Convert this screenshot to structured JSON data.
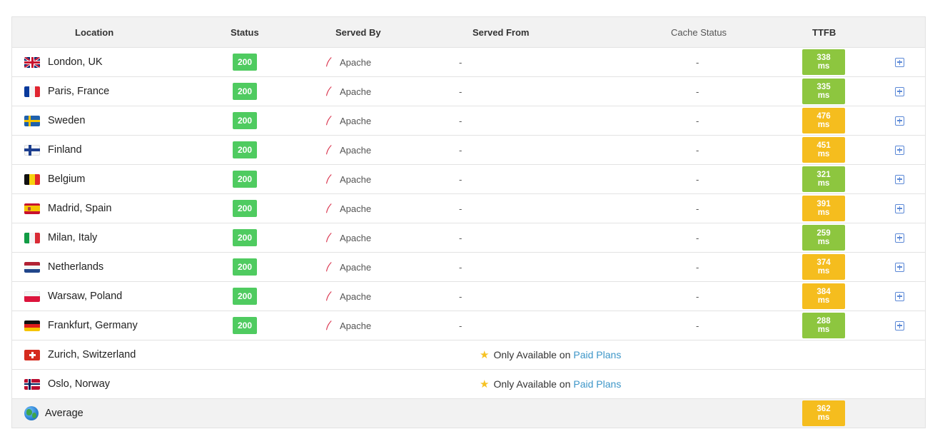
{
  "headers": {
    "location": "Location",
    "status": "Status",
    "served_by": "Served By",
    "served_from": "Served From",
    "cache_status": "Cache Status",
    "ttfb": "TTFB"
  },
  "colors": {
    "green": "#8dc63f",
    "orange": "#f5bd1e",
    "status_green": "#4fcb60",
    "link": "#3d96c8"
  },
  "rows": [
    {
      "flag": "uk",
      "location": "London, UK",
      "status": "200",
      "server": "Apache",
      "from": "-",
      "cache": "-",
      "ttfb": "338 ms",
      "level": "green"
    },
    {
      "flag": "fr",
      "location": "Paris, France",
      "status": "200",
      "server": "Apache",
      "from": "-",
      "cache": "-",
      "ttfb": "335 ms",
      "level": "green"
    },
    {
      "flag": "se",
      "location": "Sweden",
      "status": "200",
      "server": "Apache",
      "from": "-",
      "cache": "-",
      "ttfb": "476 ms",
      "level": "orange"
    },
    {
      "flag": "fi",
      "location": "Finland",
      "status": "200",
      "server": "Apache",
      "from": "-",
      "cache": "-",
      "ttfb": "451 ms",
      "level": "orange"
    },
    {
      "flag": "be",
      "location": "Belgium",
      "status": "200",
      "server": "Apache",
      "from": "-",
      "cache": "-",
      "ttfb": "321 ms",
      "level": "green"
    },
    {
      "flag": "es",
      "location": "Madrid, Spain",
      "status": "200",
      "server": "Apache",
      "from": "-",
      "cache": "-",
      "ttfb": "391 ms",
      "level": "orange"
    },
    {
      "flag": "it",
      "location": "Milan, Italy",
      "status": "200",
      "server": "Apache",
      "from": "-",
      "cache": "-",
      "ttfb": "259 ms",
      "level": "green"
    },
    {
      "flag": "nl",
      "location": "Netherlands",
      "status": "200",
      "server": "Apache",
      "from": "-",
      "cache": "-",
      "ttfb": "374 ms",
      "level": "orange"
    },
    {
      "flag": "pl",
      "location": "Warsaw, Poland",
      "status": "200",
      "server": "Apache",
      "from": "-",
      "cache": "-",
      "ttfb": "384 ms",
      "level": "orange"
    },
    {
      "flag": "de",
      "location": "Frankfurt, Germany",
      "status": "200",
      "server": "Apache",
      "from": "-",
      "cache": "-",
      "ttfb": "288 ms",
      "level": "green"
    }
  ],
  "paid_rows": [
    {
      "flag": "ch",
      "location": "Zurich, Switzerland",
      "note": "Only Available on",
      "link": "Paid Plans"
    },
    {
      "flag": "no",
      "location": "Oslo, Norway",
      "note": "Only Available on",
      "link": "Paid Plans"
    }
  ],
  "average": {
    "label": "Average",
    "ttfb": "362 ms",
    "level": "orange"
  }
}
